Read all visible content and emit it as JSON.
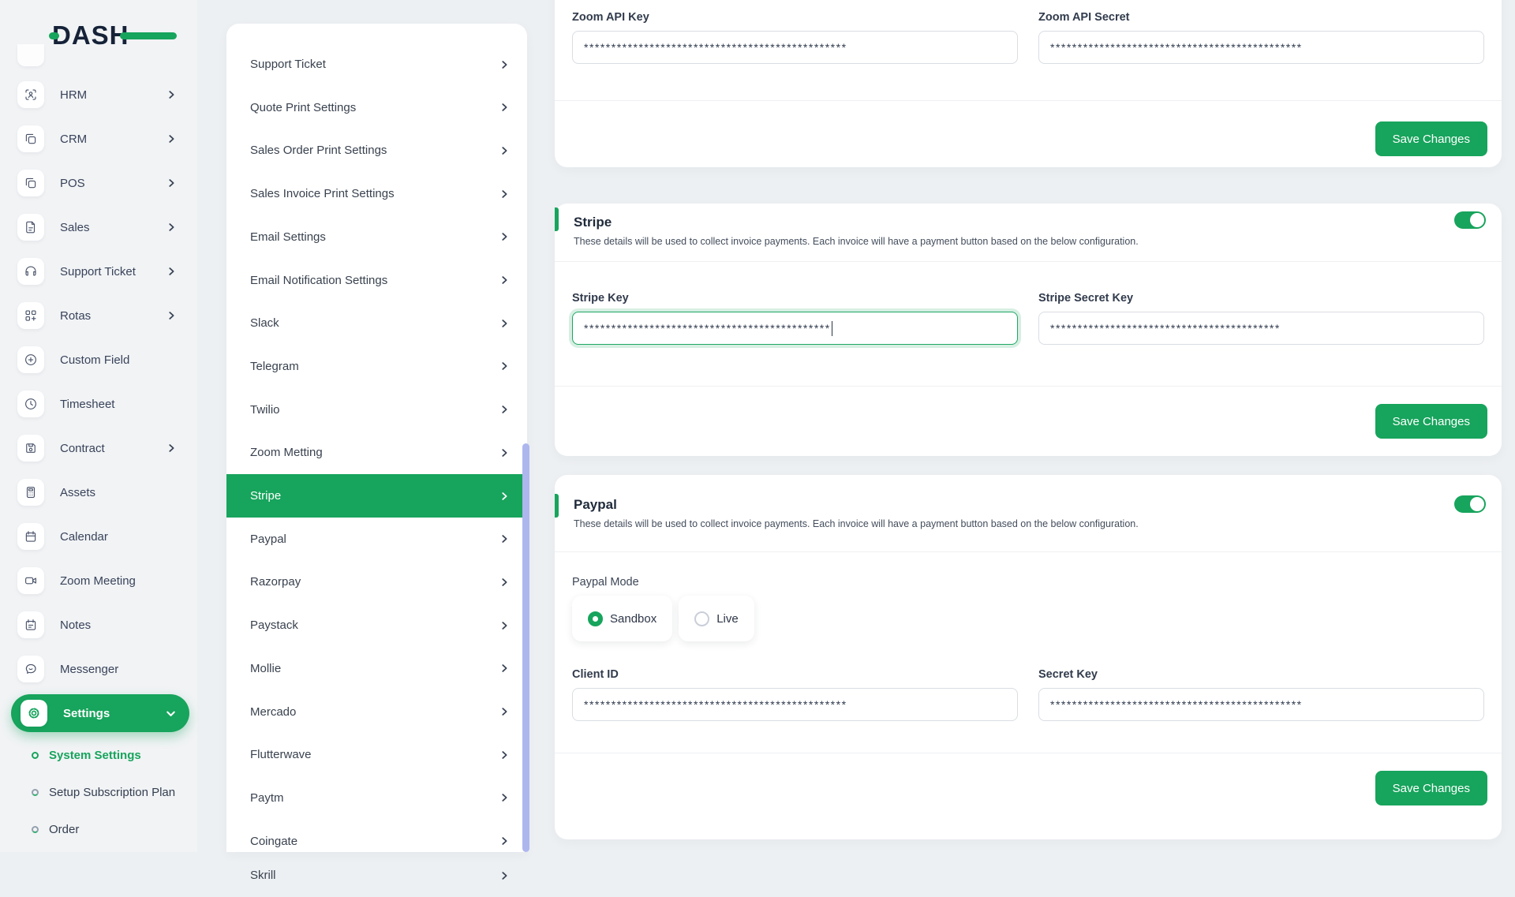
{
  "app": {
    "logo_text": "DASH"
  },
  "colors": {
    "primary_green": "#17a45c",
    "panel_scrollbar": "#adb7ee",
    "page_bg": "#edf0f3"
  },
  "sidebar": {
    "items": [
      {
        "label": "HRM"
      },
      {
        "label": "CRM"
      },
      {
        "label": "POS"
      },
      {
        "label": "Sales"
      },
      {
        "label": "Support Ticket"
      },
      {
        "label": "Rotas"
      },
      {
        "label": "Custom Field"
      },
      {
        "label": "Timesheet"
      },
      {
        "label": "Contract"
      },
      {
        "label": "Assets"
      },
      {
        "label": "Calendar"
      },
      {
        "label": "Zoom Meeting"
      },
      {
        "label": "Notes"
      },
      {
        "label": "Messenger"
      }
    ],
    "settings": {
      "label": "Settings"
    },
    "sub_items": [
      {
        "label": "System Settings"
      },
      {
        "label": "Setup Subscription Plan"
      },
      {
        "label": "Order"
      }
    ]
  },
  "settings_nav": {
    "active_item": "Stripe",
    "items": [
      "Support Ticket",
      "Quote Print Settings",
      "Sales Order Print Settings",
      "Sales Invoice Print Settings",
      "Email Settings",
      "Email Notification Settings",
      "Slack",
      "Telegram",
      "Twilio",
      "Zoom Metting",
      "Stripe",
      "Paypal",
      "Razorpay",
      "Paystack",
      "Mollie",
      "Mercado",
      "Flutterwave",
      "Paytm",
      "Coingate",
      "Skrill"
    ]
  },
  "main": {
    "zoom_card": {
      "fields": [
        {
          "label": "Zoom API Key",
          "value": "************************************************"
        },
        {
          "label": "Zoom API Secret",
          "value": "**********************************************"
        }
      ],
      "save_label": "Save Changes"
    },
    "stripe_card": {
      "title": "Stripe",
      "description": "These details will be used to collect invoice payments. Each invoice will have a payment button based on the below configuration.",
      "enabled": true,
      "fields": [
        {
          "label": "Stripe Key",
          "value": "*********************************************"
        },
        {
          "label": "Stripe Secret Key",
          "value": "******************************************"
        }
      ],
      "save_label": "Save Changes"
    },
    "paypal_card": {
      "title": "Paypal",
      "description": "These details will be used to collect invoice payments. Each invoice will have a payment button based on the below configuration.",
      "enabled": true,
      "mode_label": "Paypal Mode",
      "modes": [
        {
          "label": "Sandbox",
          "selected": true
        },
        {
          "label": "Live",
          "selected": false
        }
      ],
      "fields": [
        {
          "label": "Client ID",
          "value": "************************************************"
        },
        {
          "label": "Secret Key",
          "value": "**********************************************"
        }
      ],
      "save_label": "Save Changes"
    }
  }
}
